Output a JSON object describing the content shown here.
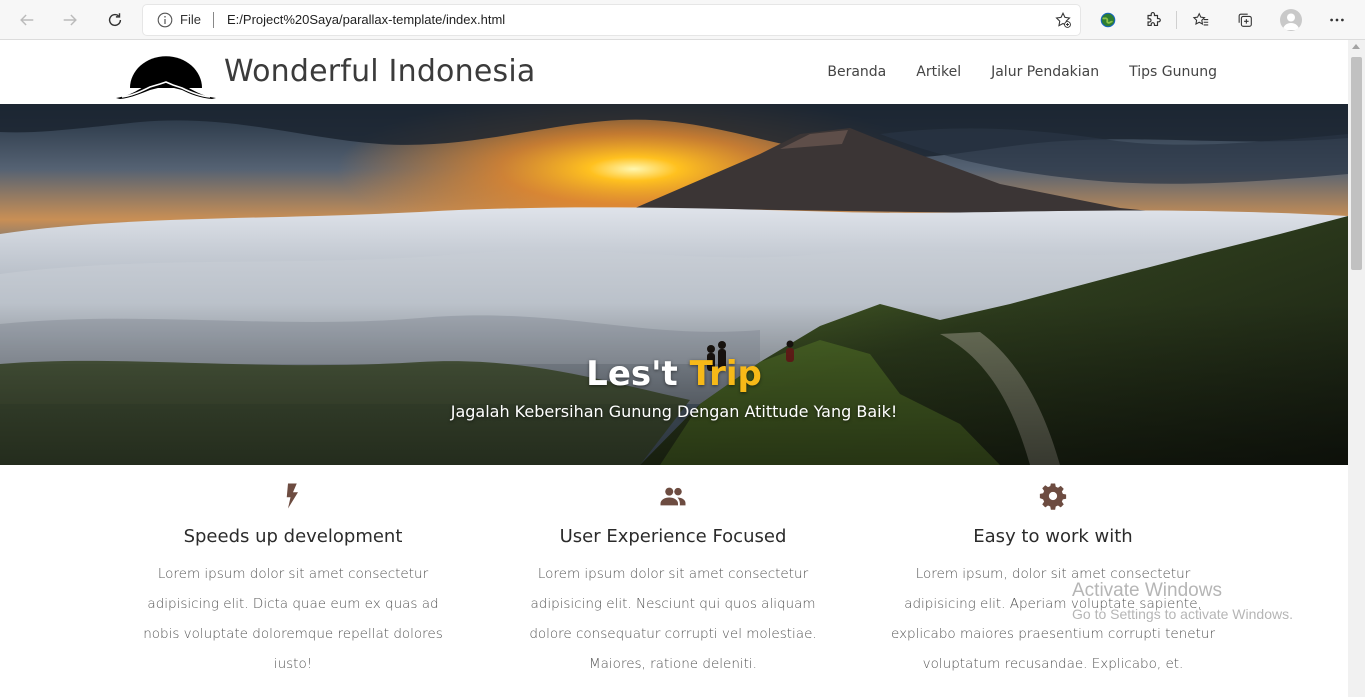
{
  "browser": {
    "file_label": "File",
    "url": "E:/Project%20Saya/parallax-template/index.html"
  },
  "site": {
    "brand": "Wonderful Indonesia",
    "nav": [
      "Beranda",
      "Artikel",
      "Jalur Pendakian",
      "Tips Gunung"
    ]
  },
  "hero": {
    "title_part1": "Les't ",
    "title_part2": "Trip",
    "subtitle": "Jagalah Kebersihan Gunung Dengan Atittude Yang Baik!"
  },
  "features": [
    {
      "icon": "bolt-icon",
      "title": "Speeds up development",
      "text": "Lorem ipsum dolor sit amet consectetur adipisicing elit. Dicta quae eum ex quas ad nobis voluptate doloremque repellat dolores iusto!"
    },
    {
      "icon": "people-icon",
      "title": "User Experience Focused",
      "text": "Lorem ipsum dolor sit amet consectetur adipisicing elit. Nesciunt qui quos aliquam dolore consequatur corrupti vel molestiae. Maiores, ratione deleniti."
    },
    {
      "icon": "gear-icon",
      "title": "Easy to work with",
      "text": "Lorem ipsum, dolor sit amet consectetur adipisicing elit. Aperiam voluptate sapiente, explicabo maiores praesentium corrupti tenetur voluptatum recusandae. Explicabo, et."
    }
  ],
  "watermark": {
    "title": "Activate Windows",
    "subtitle": "Go to Settings to activate Windows."
  },
  "colors": {
    "accent": "#f7b918",
    "icon_brown": "#6d4c41"
  }
}
